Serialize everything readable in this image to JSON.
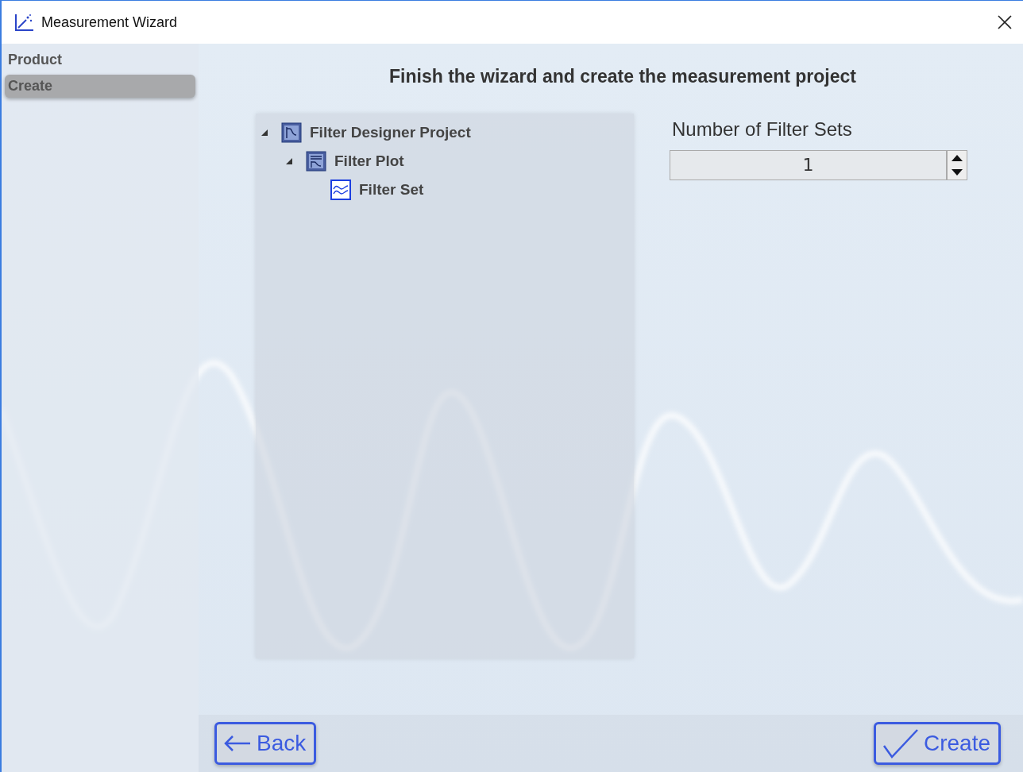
{
  "window": {
    "title": "Measurement Wizard"
  },
  "sidebar": {
    "items": [
      {
        "label": "Product",
        "selected": false
      },
      {
        "label": "Create",
        "selected": true
      }
    ]
  },
  "heading": "Finish the wizard and create the measurement project",
  "tree": [
    {
      "label": "Filter Designer Project",
      "kind": "project",
      "expanded": true,
      "children": [
        {
          "label": "Filter Plot",
          "kind": "plot",
          "expanded": true,
          "children": [
            {
              "label": "Filter Set",
              "kind": "set"
            }
          ]
        }
      ]
    }
  ],
  "filter_sets": {
    "label": "Number of Filter Sets",
    "value": "1"
  },
  "buttons": [
    {
      "label": "Back",
      "kind": "back"
    },
    {
      "label": "Create",
      "kind": "create"
    }
  ]
}
